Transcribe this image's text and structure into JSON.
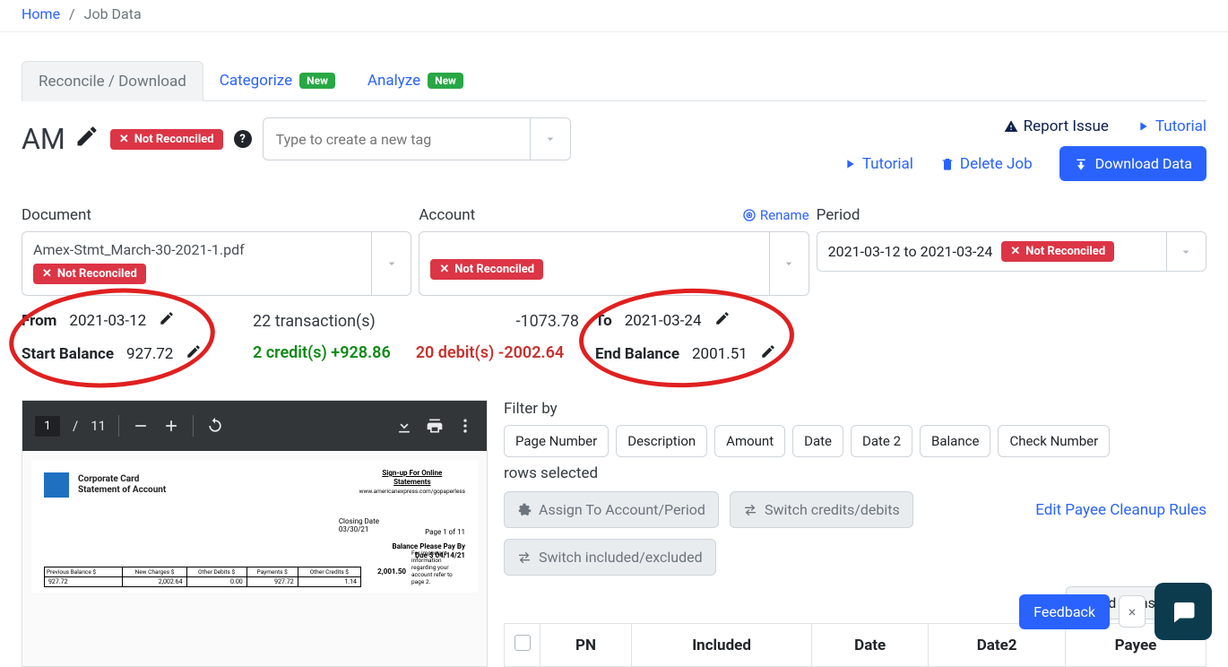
{
  "breadcrumb": {
    "home": "Home",
    "current": "Job Data"
  },
  "tabs": {
    "reconcile": "Reconcile / Download",
    "categorize": "Categorize",
    "analyze": "Analyze",
    "new_badge": "New"
  },
  "header": {
    "title": "AM",
    "not_reconciled": "Not Reconciled",
    "tag_placeholder": "Type to create a new tag",
    "report_issue": "Report Issue",
    "tutorial": "Tutorial",
    "delete_job": "Delete Job",
    "download_data": "Download Data"
  },
  "selects": {
    "document_label": "Document",
    "document_value": "Amex-Stmt_March-30-2021-1.pdf",
    "account_label": "Account",
    "rename": "Rename",
    "period_label": "Period",
    "period_value": "2021-03-12 to 2021-03-24",
    "not_reconciled": "Not Reconciled"
  },
  "stats": {
    "from_label": "From",
    "from_value": "2021-03-12",
    "start_label": "Start Balance",
    "start_value": "927.72",
    "txn_count": "22 transaction(s)",
    "net": "-1073.78",
    "credits": "2 credit(s) +928.86",
    "debits": "20 debit(s) -2002.64",
    "to_label": "To",
    "to_value": "2021-03-24",
    "end_label": "End Balance",
    "end_value": "2001.51"
  },
  "pdf": {
    "page_current": "1",
    "page_total": "11",
    "doc_title1": "Corporate Card",
    "doc_title2": "Statement of Account",
    "signup1": "Sign-up For Online",
    "signup2": "Statements",
    "signup_url": "www.americanexpress.com/gopaperless",
    "closing_label": "Closing Date",
    "closing_date": "03/30/21",
    "page_of": "Page 1 of 11",
    "bal_label": "Balance Please Pay By",
    "due_label": "Due $",
    "due_date": "04/14/21",
    "bal_num": "2,001.50",
    "bal_txt": "For important information regarding your account refer to page 2.",
    "cols": [
      "Previous Balance $",
      "New Charges $",
      "Other Debits $",
      "Payments $",
      "Other Credits $"
    ],
    "vals": [
      "927.72",
      "2,002.64",
      "0.00",
      "927.72",
      "1.14"
    ]
  },
  "filter": {
    "label": "Filter by",
    "chips": [
      "Page Number",
      "Description",
      "Amount",
      "Date",
      "Date 2",
      "Balance",
      "Check Number"
    ],
    "rows_selected": "rows selected",
    "assign": "Assign To Account/Period",
    "switch_cd": "Switch credits/debits",
    "switch_ie": "Switch included/excluded",
    "edit_payee": "Edit Payee Cleanup Rules",
    "add_trans": "Add Transaction",
    "table_headers": [
      "PN",
      "Included",
      "Date",
      "Date2",
      "Payee"
    ]
  },
  "floating": {
    "feedback": "Feedback"
  }
}
